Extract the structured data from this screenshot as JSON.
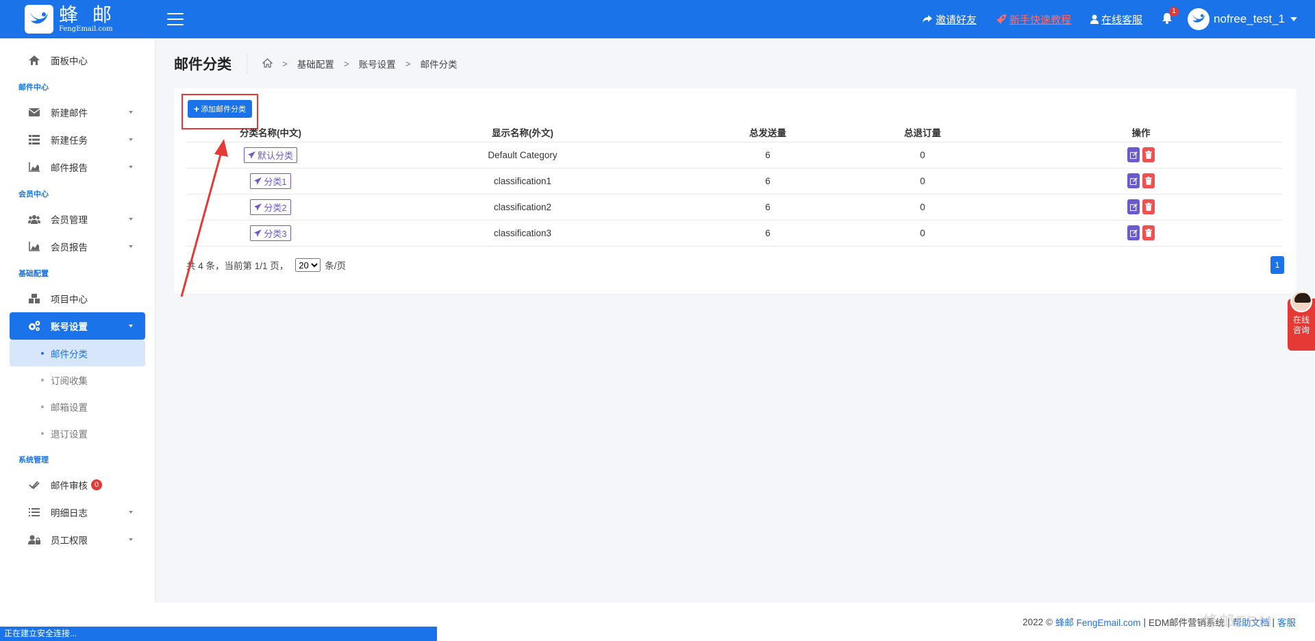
{
  "header": {
    "logo_cn": "蜂 邮",
    "logo_en": "FengEmail.com",
    "invite": "邀请好友",
    "tutorial": "新手快速教程",
    "support": "在线客服",
    "notif_count": "1",
    "username": "nofree_test_1",
    "brand_color": "#1a73e8"
  },
  "sidebar": {
    "dashboard": "面板中心",
    "sec_mail": "邮件中心",
    "new_mail": "新建邮件",
    "new_task": "新建任务",
    "mail_report": "邮件报告",
    "sec_member": "会员中心",
    "member_mgmt": "会员管理",
    "member_report": "会员报告",
    "sec_base": "基础配置",
    "project_center": "项目中心",
    "account_settings": "账号设置",
    "sub": {
      "mail_category": "邮件分类",
      "subscribe_collect": "订阅收集",
      "mailbox_settings": "邮箱设置",
      "unsubscribe_settings": "退订设置"
    },
    "sec_system": "系统管理",
    "mail_review": "邮件审核",
    "mail_review_count": "0",
    "detail_log": "明细日志",
    "staff_perm": "员工权限"
  },
  "page": {
    "title": "邮件分类",
    "breadcrumb": [
      "基础配置",
      "账号设置",
      "邮件分类"
    ]
  },
  "toolbar": {
    "add_label": "添加邮件分类"
  },
  "table": {
    "headers": [
      "分类名称(中文)",
      "显示名称(外文)",
      "总发送量",
      "总退订量",
      "操作"
    ],
    "rows": [
      {
        "cn": "默认分类",
        "en": "Default Category",
        "sent": "6",
        "unsub": "0"
      },
      {
        "cn": "分类1",
        "en": "classification1",
        "sent": "6",
        "unsub": "0"
      },
      {
        "cn": "分类2",
        "en": "classification2",
        "sent": "6",
        "unsub": "0"
      },
      {
        "cn": "分类3",
        "en": "classification3",
        "sent": "6",
        "unsub": "0"
      }
    ]
  },
  "pager": {
    "summary": "共 4 条，当前第 1/1 页，",
    "page_size": "20",
    "unit": "条/页",
    "current_page": "1"
  },
  "consult": {
    "line1": "在线",
    "line2": "咨询"
  },
  "footer": {
    "copyright": "2022 ©",
    "brand": "蜂邮 FengEmail.com",
    "sep1": "|",
    "system": "EDM邮件营销系统",
    "sep2": "|",
    "help": "帮助文档",
    "sep3": "|",
    "service": "客服",
    "watermark": "蜂邮EDM"
  },
  "statusbar": "正在建立安全连接..."
}
